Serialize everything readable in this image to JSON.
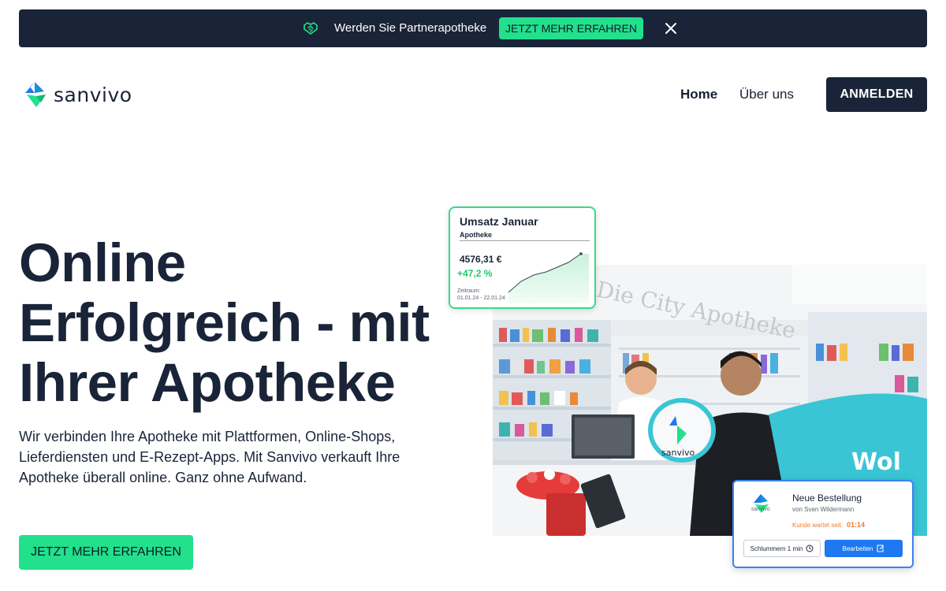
{
  "banner": {
    "icon": "handshake-icon",
    "text": "Werden Sie Partnerapotheke",
    "cta_label": "JETZT MEHR ERFAHREN",
    "close_icon": "close-icon"
  },
  "header": {
    "logo_text_part1": "san",
    "logo_text_part2": "vivo",
    "nav": [
      {
        "label": "Home"
      },
      {
        "label": "Über uns"
      }
    ],
    "login_label": "ANMELDEN"
  },
  "hero": {
    "title_lines": [
      "Online",
      "Erfolgreich - mit",
      "Ihrer Apotheke"
    ],
    "subtitle_lines": [
      "Wir verbinden Ihre Apotheke mit Plattformen, Online-Shops,",
      "Lieferdiensten und E-Rezept-Apps. Mit Sanvivo verkauft Ihre",
      "Apotheke überall online. Ganz ohne Aufwand."
    ],
    "cta_label": "JETZT MEHR ERFAHREN"
  },
  "revenue_card": {
    "title": "Umsatz Januar",
    "subtitle": "Apotheke",
    "amount": "4576,31 €",
    "change": "+47,2 %",
    "period_label": "Zeitraum:",
    "period": "01.01.24 - 22.01.24"
  },
  "photo": {
    "store_sign": "Die City Apotheke",
    "box_label": "sanvivo",
    "bag_label": "Wol"
  },
  "order_card": {
    "logo_text": "sanvivo",
    "title": "Neue Bestellung",
    "from": "von Sven Wildermann",
    "wait_label": "Kunde wartet seit:",
    "wait_time": "01:14",
    "snooze_label": "Schlummern 1 min",
    "edit_label": "Bearbeiten"
  },
  "colors": {
    "navy": "#1a2438",
    "accent_green": "#22e08b",
    "blue": "#1e78f0",
    "orange": "#f07c30"
  }
}
